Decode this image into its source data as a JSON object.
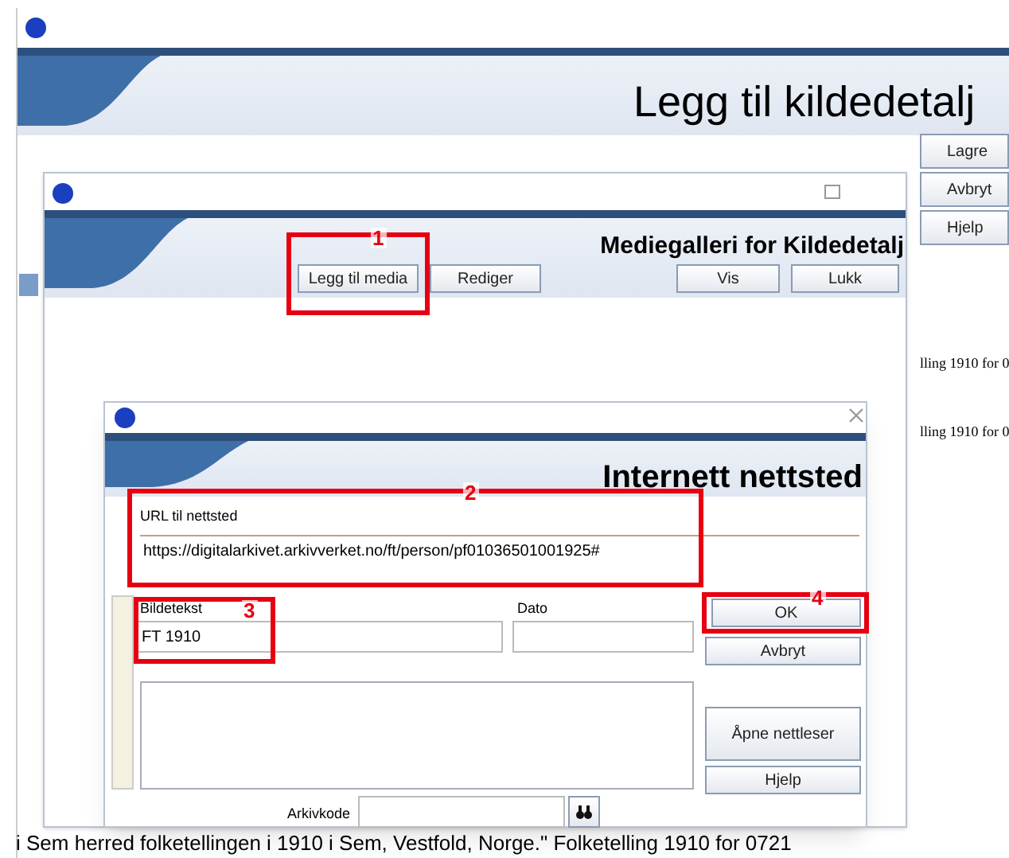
{
  "main_window": {
    "heading": "Legg til kildedetalj",
    "buttons": [
      "Lagre",
      "Avbryt",
      "Hjelp"
    ],
    "side_texts": [
      "lling 1910 for 0",
      "lling 1910 for 0"
    ],
    "footer_text": "i Sem herred folketellingen i 1910 i Sem, Vestfold, Norge.\" Folketelling 1910 for 0721"
  },
  "media_window": {
    "heading": "Mediegalleri for Kildedetalj",
    "buttons": [
      "Legg til media",
      "Rediger",
      "Vis",
      "Lukk"
    ]
  },
  "website_dialog": {
    "heading": "Internett nettsted",
    "url": {
      "label": "URL til nettsted",
      "value": "https://digitalarkivet.arkivverket.no/ft/person/pf01036501001925#"
    },
    "caption": {
      "label": "Bildetekst",
      "value": "FT 1910"
    },
    "date": {
      "label": "Dato"
    },
    "archive_code": {
      "label": "Arkivkode"
    },
    "buttons": [
      "OK",
      "Avbryt",
      "Åpne nettleser",
      "Hjelp"
    ]
  },
  "annotations": [
    {
      "label": "1"
    },
    {
      "label": "2"
    },
    {
      "label": "3"
    },
    {
      "label": "4"
    }
  ]
}
